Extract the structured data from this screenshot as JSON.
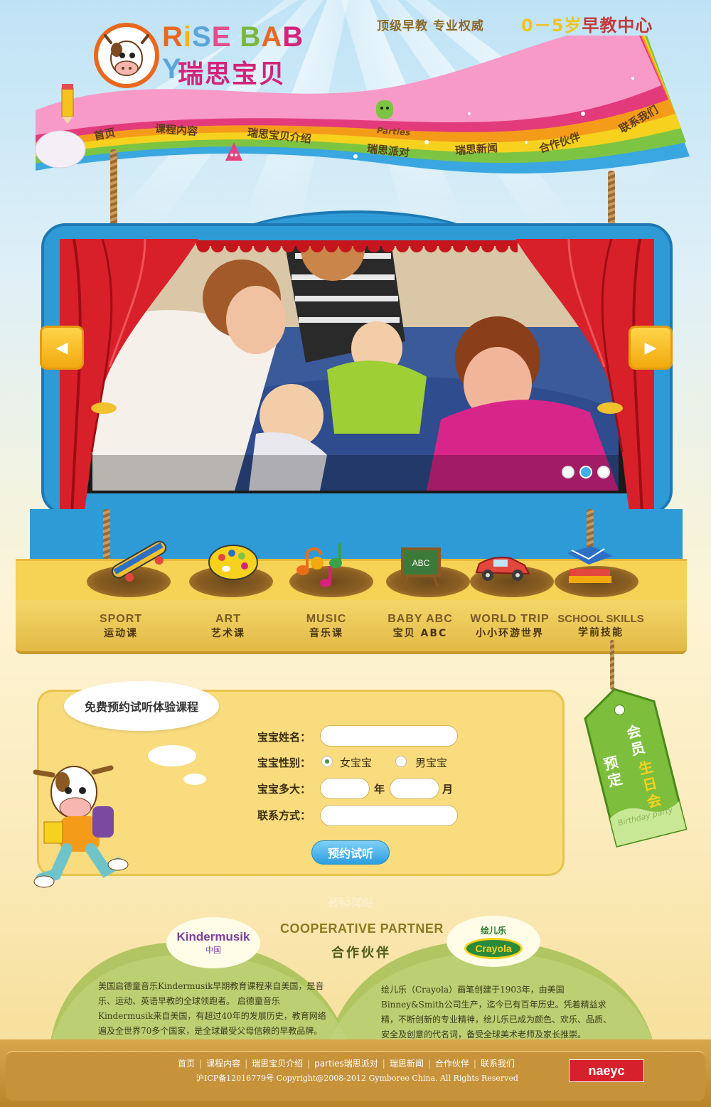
{
  "header": {
    "logo_en_letters": [
      "R",
      "i",
      "S",
      "E",
      " ",
      "B",
      "A",
      "B",
      "Y"
    ],
    "logo_en_colors": [
      "#e8681f",
      "#f2b515",
      "#5aa6d8",
      "#e24d8c",
      "#fff",
      "#7bb73c",
      "#e8681f",
      "#d3237b",
      "#5aa6d8"
    ],
    "logo_cn": "瑞思宝贝",
    "slogan": "顶级早教  专业权威",
    "age_range": "0－5岁",
    "age_center": "早教中心"
  },
  "nav": {
    "items": [
      {
        "label": "首页"
      },
      {
        "label": "课程内容"
      },
      {
        "label": "瑞思宝贝介绍"
      },
      {
        "label": "瑞思派对",
        "sub": "Parties"
      },
      {
        "label": "瑞思新闻"
      },
      {
        "label": "合作伙伴"
      },
      {
        "label": "联系我们"
      }
    ]
  },
  "slider": {
    "prev_icon": "◀",
    "next_icon": "▶",
    "dots": 3,
    "active_dot": 2
  },
  "categories": [
    {
      "en": "SPORT",
      "cn": "运动课",
      "icon": "skateboard-icon"
    },
    {
      "en": "ART",
      "cn": "艺术课",
      "icon": "palette-icon"
    },
    {
      "en": "MUSIC",
      "cn": "音乐课",
      "icon": "music-notes-icon"
    },
    {
      "en": "BABY ABC",
      "cn": "宝贝 ABC",
      "icon": "chalkboard-icon"
    },
    {
      "en": "WORLD TRIP",
      "cn": "小小环游世界",
      "icon": "car-icon"
    },
    {
      "en": "SCHOOL SKILLS",
      "cn": "学前技能",
      "icon": "books-icon"
    }
  ],
  "form": {
    "bubble_title": "免费预约试听体验课程",
    "name_label": "宝宝姓名：",
    "name_value": "",
    "gender_label": "宝宝性别：",
    "gender_girl": "女宝宝",
    "gender_boy": "男宝宝",
    "age_label": "宝宝多大：",
    "year_unit": "年",
    "month_unit": "月",
    "contact_label": "联系方式：",
    "contact_value": "",
    "submit": "预约试听"
  },
  "tag": {
    "line1": "会员",
    "line2": "生日会",
    "line3": "预定",
    "sub": "Birthday party"
  },
  "partners": {
    "title_en": "COOPERATIVE PARTNER",
    "title_cn": "合作伙伴",
    "left_logo": "Kindermusik",
    "left_logo_sub": "中国",
    "left_text": "美国启德童音乐Kindermusik早期教育课程来自美国，是音乐、运动、英语早教的全球领跑者。 启德童音乐Kindermusik来自美国，有超过40年的发展历史，教育网络遍及全世界70多个国家，是全球最受父母信赖的早教品牌。",
    "right_logo_cn": "绘儿乐",
    "right_logo": "Crayola",
    "right_text": "绘儿乐（Crayola）画笔创建于1903年，由美国Binney&Smith公司生产，迄今已有百年历史。凭着精益求精，不断创新的专业精神，绘儿乐已成为颜色、欢乐、品质、安全及创意的代名词，备受全球美术老师及家长推崇。"
  },
  "footer": {
    "links": [
      "首页",
      "课程内容",
      "瑞思宝贝介绍",
      "parties瑞思派对",
      "瑞思新闻",
      "合作伙伴",
      "联系我们"
    ],
    "copyright": "沪ICP备12016779号 Copyright@2008-2012 Gymboree China. All Rights Reserved",
    "badge": "naeyc"
  }
}
